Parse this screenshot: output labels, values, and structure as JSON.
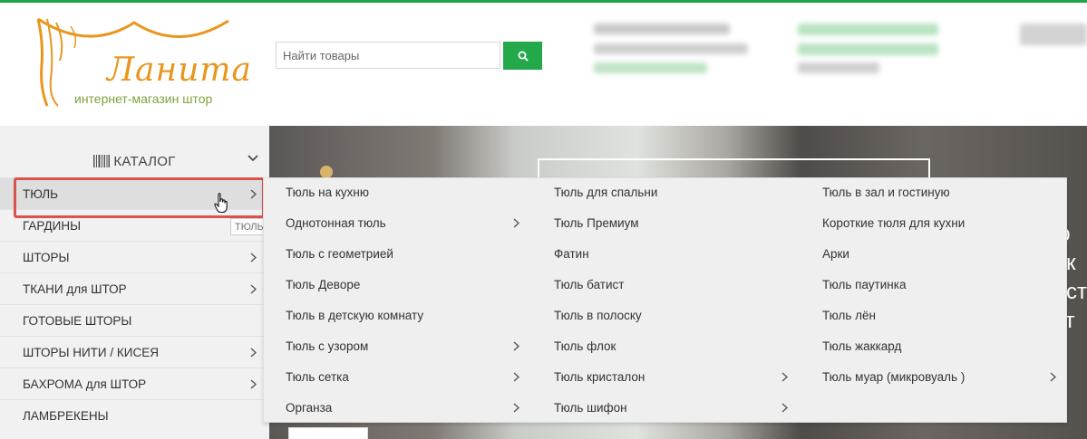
{
  "colors": {
    "accent_green": "#23a84a",
    "topbar_green": "#1fa34a",
    "logo_orange": "#e8961e",
    "logo_green": "#7da23b",
    "highlight_red": "#d9534f"
  },
  "header": {
    "logo_text": "Ланита",
    "logo_subtitle": "интернет-магазин штор",
    "search_placeholder": "Найти товары",
    "search_icon": "search-icon"
  },
  "sidebar": {
    "catalog_label": "КАТАЛОГ",
    "items": [
      {
        "label": "ТЮЛЬ",
        "has_submenu": true,
        "active": true
      },
      {
        "label": "ГАРДИНЫ",
        "has_submenu": true,
        "active": false
      },
      {
        "label": "ШТОРЫ",
        "has_submenu": true,
        "active": false
      },
      {
        "label": "ТКАНИ для ШТОР",
        "has_submenu": true,
        "active": false
      },
      {
        "label": "ГОТОВЫЕ ШТОРЫ",
        "has_submenu": false,
        "active": false
      },
      {
        "label": "ШТОРЫ НИТИ / КИСЕЯ",
        "has_submenu": true,
        "active": false
      },
      {
        "label": "БАХРОМА для ШТОР",
        "has_submenu": true,
        "active": false
      },
      {
        "label": "ЛАМБРЕКЕНЫ",
        "has_submenu": false,
        "active": false
      }
    ],
    "tooltip": "ТЮЛЬ"
  },
  "banner": {
    "side_text": [
      "ю",
      "ек",
      "ост",
      "ст"
    ]
  },
  "dropdown": {
    "columns": [
      [
        {
          "label": "Тюль на кухню",
          "has_submenu": false
        },
        {
          "label": "Однотонная тюль",
          "has_submenu": true
        },
        {
          "label": "Тюль с геометрией",
          "has_submenu": false
        },
        {
          "label": "Тюль Деворе",
          "has_submenu": false
        },
        {
          "label": "Тюль в детскую комнату",
          "has_submenu": false
        },
        {
          "label": "Тюль с узором",
          "has_submenu": true
        },
        {
          "label": "Тюль сетка",
          "has_submenu": true
        },
        {
          "label": "Органза",
          "has_submenu": true
        }
      ],
      [
        {
          "label": "Тюль для спальни",
          "has_submenu": false
        },
        {
          "label": "Тюль Премиум",
          "has_submenu": false
        },
        {
          "label": "Фатин",
          "has_submenu": false
        },
        {
          "label": "Тюль батист",
          "has_submenu": false
        },
        {
          "label": "Тюль в полоску",
          "has_submenu": false
        },
        {
          "label": "Тюль флок",
          "has_submenu": false
        },
        {
          "label": "Тюль кристалон",
          "has_submenu": true
        },
        {
          "label": "Тюль шифон",
          "has_submenu": true
        }
      ],
      [
        {
          "label": "Тюль в зал и гостиную",
          "has_submenu": false
        },
        {
          "label": "Короткие тюля для кухни",
          "has_submenu": false
        },
        {
          "label": "Арки",
          "has_submenu": false
        },
        {
          "label": "Тюль паутинка",
          "has_submenu": false
        },
        {
          "label": "Тюль лён",
          "has_submenu": false
        },
        {
          "label": "Тюль жаккард",
          "has_submenu": false
        },
        {
          "label": "Тюль муар (микровуаль )",
          "has_submenu": true
        }
      ]
    ]
  }
}
